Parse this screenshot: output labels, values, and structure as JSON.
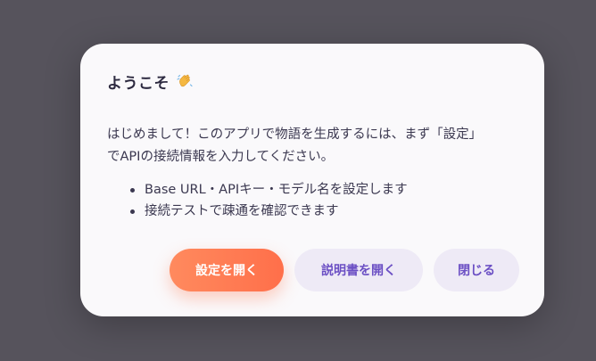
{
  "dialog": {
    "title": "ようこそ",
    "title_icon": "waving-hand-icon",
    "body_line1": "はじめまして！このアプリで物語を生成するには、まず「設定」",
    "body_line2": "でAPIの接続情報を入力してください。",
    "bullets": [
      "Base URL・APIキー・モデル名を設定します",
      "接続テストで疎通を確認できます"
    ],
    "buttons": {
      "open_settings": "設定を開く",
      "open_manual": "説明書を開く",
      "close": "閉じる"
    }
  },
  "colors": {
    "overlay": "#56535c",
    "dialog_bg": "#faf9fb",
    "primary_start": "#ff8a5e",
    "primary_end": "#ff6f4a",
    "secondary_bg": "#eeeaf6",
    "secondary_text": "#6b4fc4"
  }
}
